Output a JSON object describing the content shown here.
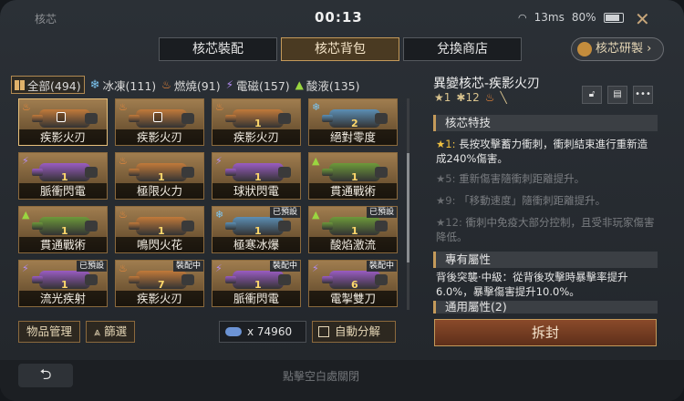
{
  "window": {
    "title": "核芯",
    "clock": "00:13",
    "latency": "13ms",
    "battery": "80%"
  },
  "tabs": [
    "核芯裝配",
    "核芯背包",
    "兌換商店"
  ],
  "research_button": "核芯研製",
  "filters": [
    {
      "label": "全部(494)",
      "icon": "grid-icon"
    },
    {
      "label": "冰凍(111)",
      "icon": "snowflake-icon"
    },
    {
      "label": "燃燒(91)",
      "icon": "flame-icon"
    },
    {
      "label": "電磁(157)",
      "icon": "lightning-icon"
    },
    {
      "label": "酸液(135)",
      "icon": "droplet-icon"
    }
  ],
  "cards": [
    {
      "name": "疾影火刃",
      "lvl": "",
      "tag": "",
      "locked": true,
      "elem": "fire",
      "color": "#c27a3a"
    },
    {
      "name": "疾影火刃",
      "lvl": "",
      "tag": "",
      "locked": true,
      "elem": "fire",
      "color": "#c27a3a"
    },
    {
      "name": "疾影火刃",
      "lvl": "1",
      "tag": "",
      "locked": false,
      "elem": "fire",
      "color": "#c27a3a"
    },
    {
      "name": "絕對零度",
      "lvl": "2",
      "tag": "",
      "locked": false,
      "elem": "ice",
      "color": "#5c8fb5"
    },
    {
      "name": "脈衝閃電",
      "lvl": "1",
      "tag": "",
      "locked": false,
      "elem": "elec",
      "color": "#9a5cc2"
    },
    {
      "name": "極限火力",
      "lvl": "1",
      "tag": "",
      "locked": false,
      "elem": "fire",
      "color": "#c27a3a"
    },
    {
      "name": "球狀閃電",
      "lvl": "1",
      "tag": "",
      "locked": false,
      "elem": "elec",
      "color": "#9a5cc2"
    },
    {
      "name": "貫通戰術",
      "lvl": "1",
      "tag": "",
      "locked": false,
      "elem": "acid",
      "color": "#6d9a3a"
    },
    {
      "name": "貫通戰術",
      "lvl": "1",
      "tag": "",
      "locked": false,
      "elem": "acid",
      "color": "#6d9a3a"
    },
    {
      "name": "鳴閃火花",
      "lvl": "1",
      "tag": "",
      "locked": false,
      "elem": "fire",
      "color": "#c27a3a"
    },
    {
      "name": "極寒冰爆",
      "lvl": "1",
      "tag": "已預設",
      "locked": false,
      "elem": "ice",
      "color": "#5c8fb5"
    },
    {
      "name": "酸焰激流",
      "lvl": "1",
      "tag": "已預設",
      "locked": false,
      "elem": "acid",
      "color": "#6d9a3a"
    },
    {
      "name": "流光疾射",
      "lvl": "1",
      "tag": "已預設",
      "locked": false,
      "elem": "elec",
      "color": "#9a5cc2"
    },
    {
      "name": "疾影火刃",
      "lvl": "7",
      "tag": "裝配中",
      "locked": false,
      "elem": "fire",
      "color": "#c27a3a"
    },
    {
      "name": "脈衝閃電",
      "lvl": "1",
      "tag": "裝配中",
      "locked": false,
      "elem": "elec",
      "color": "#9a5cc2"
    },
    {
      "name": "電掣雙刀",
      "lvl": "6",
      "tag": "裝配中",
      "locked": false,
      "elem": "elec",
      "color": "#9a5cc2"
    }
  ],
  "buttons": {
    "manage": "物品管理",
    "filter": "篩選",
    "currency": "x 74960",
    "auto": "自動分解",
    "unseal": "拆封"
  },
  "detail": {
    "title": "異變核芯-疾影火刃",
    "meta": {
      "stars": "1",
      "level": "12"
    },
    "sections": {
      "skill": "核芯特技",
      "exclusive": "專有屬性",
      "general": "通用屬性(2)"
    },
    "skills": [
      {
        "star": "★1:",
        "text": "長按攻擊蓄力衝刺，衝刺結束進行重新造成240%傷害。",
        "dim": false
      },
      {
        "star": "★5:",
        "text": "重新傷害隨衝刺距離提升。",
        "dim": true
      },
      {
        "star": "★9:",
        "text": "「移動速度」隨衝刺距離提升。",
        "dim": true
      },
      {
        "star": "★12:",
        "text": "衝刺中免疫大部分控制，且受非玩家傷害降低。",
        "dim": true
      }
    ],
    "exclusive_text": "背後突襲·中級：從背後攻擊時暴擊率提升6.0%，暴擊傷害提升10.0%。"
  },
  "footer": {
    "hint": "點擊空白處關閉"
  },
  "colors": {
    "accent": "#c49a5a",
    "unseal": "#8a4a2a"
  }
}
